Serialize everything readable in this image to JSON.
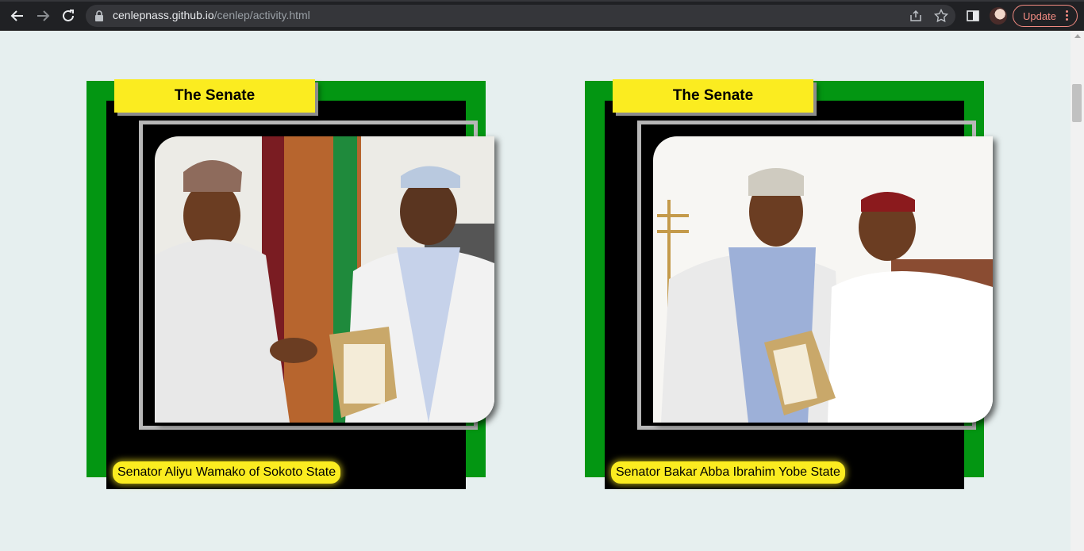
{
  "browser": {
    "url_host": "cenlepnass.github.io",
    "url_path": "/cenlep/activity.html",
    "update_label": "Update"
  },
  "cards": [
    {
      "title": "The Senate",
      "caption": "Senator Aliyu Wamako of Sokoto State"
    },
    {
      "title": "The Senate",
      "caption": "Senator Bakar Abba Ibrahim Yobe State"
    }
  ],
  "colors": {
    "page_bg": "#e6efef",
    "card_green": "#039612",
    "title_yellow": "#fbec20"
  }
}
